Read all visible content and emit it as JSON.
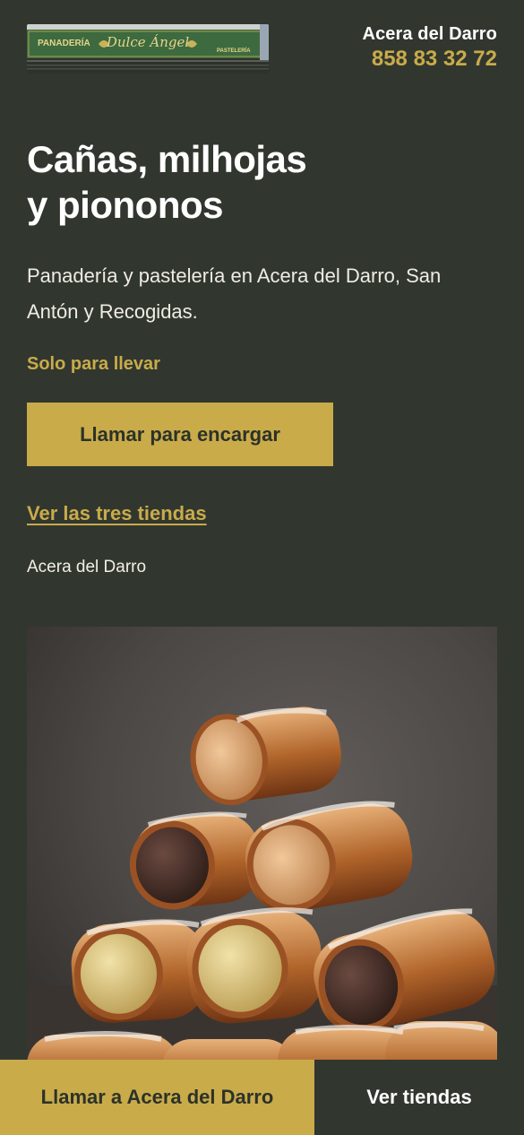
{
  "header": {
    "logo_text_left": "PANADERÍA",
    "logo_text_center": "Dulce Ángel",
    "logo_text_right": "PASTELERÍA",
    "store_name": "Acera del Darro",
    "phone": "858 83 32 72"
  },
  "hero": {
    "title_line1": "Cañas, milhojas",
    "title_line2": "y piononos",
    "description": "Panadería y pastelería en Acera del Darro, San Antón y Recogidas.",
    "takeaway_note": "Solo para llevar",
    "cta_label": "Llamar para encargar",
    "stores_link": "Ver las tres tiendas",
    "current_store": "Acera del Darro"
  },
  "bottom_bar": {
    "call_label": "Llamar a Acera del Darro",
    "stores_label": "Ver tiendas"
  },
  "colors": {
    "background": "#31372f",
    "accent": "#c9ab4a",
    "text": "#ffffff"
  }
}
